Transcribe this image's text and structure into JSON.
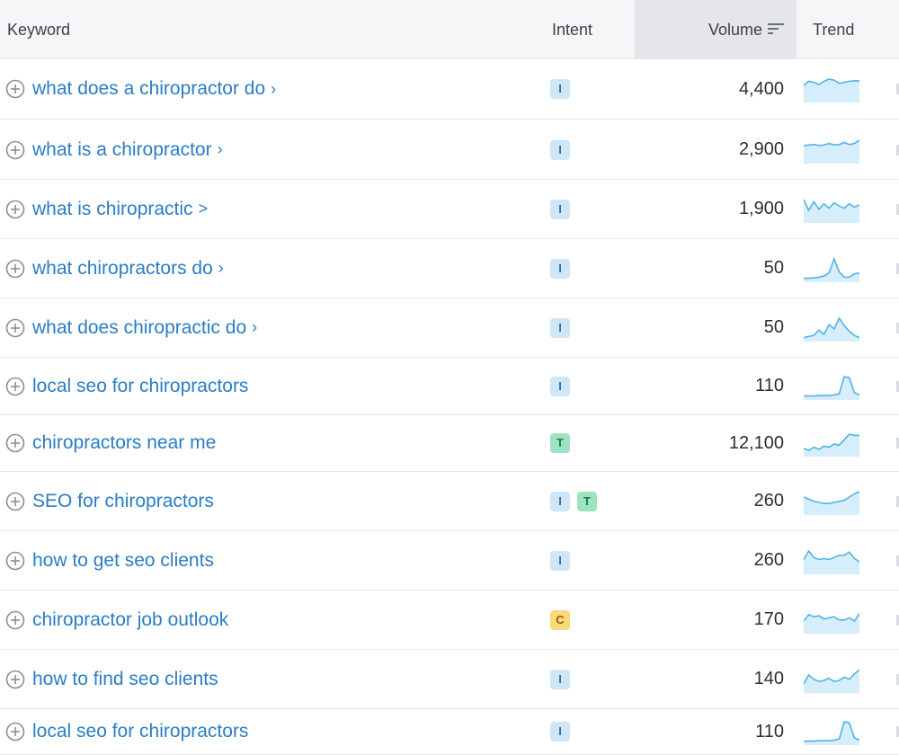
{
  "header": {
    "keyword": "Keyword",
    "intent": "Intent",
    "volume": "Volume",
    "trend": "Trend",
    "sort_icon": "sort-descending-icon"
  },
  "colors": {
    "link": "#2a7dc4",
    "trend_line": "#4fb3e8",
    "trend_fill": "#d6eefb",
    "intent_informational": "#cfe5f8",
    "intent_transactional": "#9ee3c1",
    "intent_commercial": "#fbd878"
  },
  "rows": [
    {
      "keyword": "what does a chiropractor do",
      "chevron": "›",
      "intents": [
        "I"
      ],
      "volume": "4,400",
      "trend": [
        0.7,
        0.9,
        0.85,
        0.75,
        0.9,
        1.0,
        0.95,
        0.8,
        0.85,
        0.9,
        0.92,
        0.92
      ]
    },
    {
      "keyword": "what is a chiropractor",
      "chevron": "›",
      "intents": [
        "I"
      ],
      "volume": "2,900",
      "trend": [
        0.75,
        0.78,
        0.8,
        0.76,
        0.78,
        0.85,
        0.78,
        0.8,
        0.9,
        0.8,
        0.85,
        1.0
      ]
    },
    {
      "keyword": "what is chiropractic",
      "chevron": ">",
      "intents": [
        "I"
      ],
      "volume": "1,900",
      "trend": [
        1.0,
        0.5,
        0.9,
        0.55,
        0.8,
        0.6,
        0.85,
        0.7,
        0.6,
        0.8,
        0.65,
        0.75
      ]
    },
    {
      "keyword": "what chiropractors do",
      "chevron": "›",
      "intents": [
        "I"
      ],
      "volume": "50",
      "trend": [
        0.1,
        0.1,
        0.12,
        0.15,
        0.2,
        0.35,
        1.0,
        0.4,
        0.15,
        0.15,
        0.3,
        0.35
      ]
    },
    {
      "keyword": "what does chiropractic do",
      "chevron": "›",
      "intents": [
        "I"
      ],
      "volume": "50",
      "trend": [
        0.1,
        0.15,
        0.2,
        0.45,
        0.25,
        0.7,
        0.5,
        1.0,
        0.65,
        0.4,
        0.2,
        0.1
      ]
    },
    {
      "keyword": "local seo for chiropractors",
      "chevron": "",
      "intents": [
        "I"
      ],
      "volume": "110",
      "trend": [
        0.1,
        0.1,
        0.1,
        0.12,
        0.12,
        0.12,
        0.15,
        0.2,
        1.0,
        0.95,
        0.25,
        0.15
      ]
    },
    {
      "keyword": "chiropractors near me",
      "chevron": "",
      "intents": [
        "T"
      ],
      "volume": "12,100",
      "trend": [
        0.3,
        0.2,
        0.35,
        0.25,
        0.4,
        0.35,
        0.5,
        0.45,
        0.7,
        0.95,
        0.9,
        0.9
      ]
    },
    {
      "keyword": "SEO for chiropractors",
      "chevron": "",
      "intents": [
        "I",
        "T"
      ],
      "volume": "260",
      "trend": [
        0.75,
        0.65,
        0.55,
        0.5,
        0.45,
        0.45,
        0.5,
        0.55,
        0.6,
        0.75,
        0.9,
        1.0
      ]
    },
    {
      "keyword": "how to get seo clients",
      "chevron": "",
      "intents": [
        "I"
      ],
      "volume": "260",
      "trend": [
        0.6,
        1.0,
        0.7,
        0.6,
        0.65,
        0.6,
        0.7,
        0.8,
        0.8,
        0.95,
        0.65,
        0.5
      ]
    },
    {
      "keyword": "chiropractor job outlook",
      "chevron": "",
      "intents": [
        "C"
      ],
      "volume": "170",
      "trend": [
        0.5,
        0.8,
        0.7,
        0.75,
        0.6,
        0.65,
        0.7,
        0.55,
        0.55,
        0.65,
        0.5,
        0.85
      ]
    },
    {
      "keyword": "how to find seo clients",
      "chevron": "",
      "intents": [
        "I"
      ],
      "volume": "140",
      "trend": [
        0.35,
        0.75,
        0.55,
        0.45,
        0.5,
        0.6,
        0.45,
        0.5,
        0.65,
        0.55,
        0.8,
        1.0
      ]
    },
    {
      "keyword": "local seo for chiropractors",
      "chevron": "",
      "intents": [
        "I"
      ],
      "volume": "110",
      "trend": [
        0.1,
        0.1,
        0.1,
        0.12,
        0.12,
        0.12,
        0.15,
        0.2,
        1.0,
        0.95,
        0.25,
        0.15
      ]
    }
  ]
}
